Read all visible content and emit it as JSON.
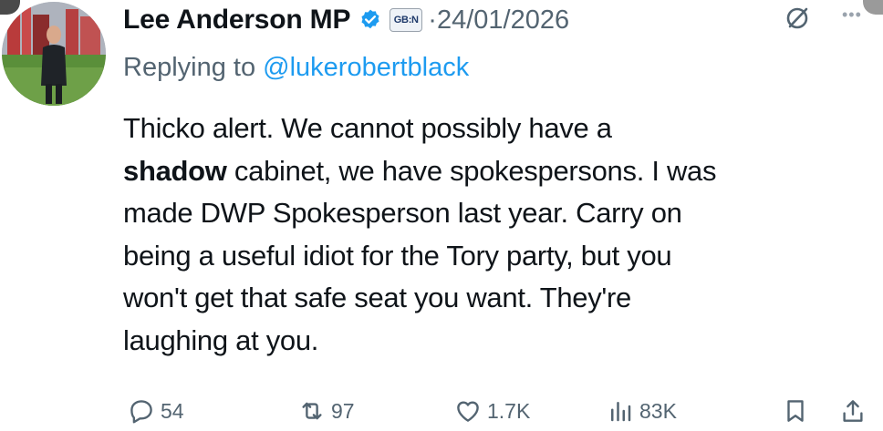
{
  "author": {
    "name": "Lee Anderson MP",
    "org_badge": "GB:N",
    "date": "24/01/2026",
    "separator": "·"
  },
  "reply": {
    "prefix": "Replying to",
    "handle": "@lukerobertblack"
  },
  "tweet": {
    "lines": [
      {
        "pre": "Thicko alert. We cannot possibly have a",
        "bold": "",
        "post": ""
      },
      {
        "pre": "",
        "bold": "shadow",
        "post": " cabinet, we have spokespersons. I was"
      },
      {
        "pre": "made DWP Spokesperson last year. Carry on",
        "bold": "",
        "post": ""
      },
      {
        "pre": "being a useful idiot for the Tory party, but you",
        "bold": "",
        "post": ""
      },
      {
        "pre": "won't get that safe seat you want. They're",
        "bold": "",
        "post": ""
      },
      {
        "pre": "laughing at you.",
        "bold": "",
        "post": ""
      }
    ]
  },
  "actions": {
    "replies": "54",
    "reposts": "97",
    "likes": "1.7K",
    "views": "83K"
  },
  "icons": {
    "verified": "verified-badge-icon",
    "grok": "grok-icon",
    "more": "more-icon",
    "reply": "reply-icon",
    "repost": "repost-icon",
    "like": "heart-icon",
    "views": "views-icon",
    "bookmark": "bookmark-icon",
    "share": "share-icon"
  },
  "colors": {
    "text": "#0f1419",
    "secondary": "#536471",
    "link": "#1d9bf0",
    "verified": "#1d9bf0"
  }
}
